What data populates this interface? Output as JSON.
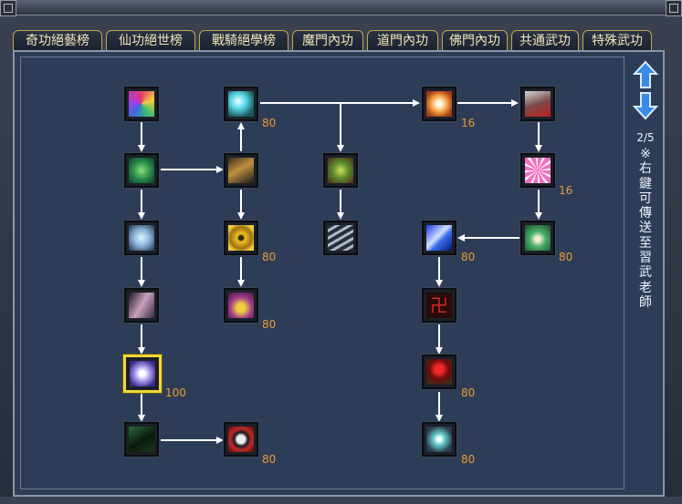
{
  "tabs": [
    {
      "label": "奇功絕藝榜",
      "active": true
    },
    {
      "label": "仙功絕世榜",
      "active": false
    },
    {
      "label": "戰騎絕學榜",
      "active": false
    },
    {
      "label": "魔門內功",
      "active": false
    },
    {
      "label": "道門內功",
      "active": false
    },
    {
      "label": "佛門內功",
      "active": false
    },
    {
      "label": "共通武功",
      "active": false
    },
    {
      "label": "特殊武功",
      "active": false
    }
  ],
  "side": {
    "page_indicator": "2/5",
    "hint": "※右鍵可傳送至習武老師",
    "up_arrow": "arrow-up-icon",
    "down_arrow": "arrow-down-icon"
  },
  "skills": [
    {
      "name": "rainbow-wave",
      "level": "",
      "selected": false
    },
    {
      "name": "ice-shards",
      "level": "80",
      "selected": false
    },
    {
      "name": "glowing-hand",
      "level": "16",
      "selected": false
    },
    {
      "name": "crimson-cloak",
      "level": "",
      "selected": false
    },
    {
      "name": "green-leaf",
      "level": "",
      "selected": false
    },
    {
      "name": "dark-peak",
      "level": "",
      "selected": false
    },
    {
      "name": "green-vortex",
      "level": "",
      "selected": false
    },
    {
      "name": "pink-bloom",
      "level": "16",
      "selected": false
    },
    {
      "name": "frost-burst",
      "level": "",
      "selected": false
    },
    {
      "name": "golden-seal",
      "level": "80",
      "selected": false
    },
    {
      "name": "steel-wings",
      "level": "",
      "selected": false
    },
    {
      "name": "blue-slash",
      "level": "80",
      "selected": false
    },
    {
      "name": "lotus-figure",
      "level": "80",
      "selected": false
    },
    {
      "name": "violet-feather",
      "level": "",
      "selected": false
    },
    {
      "name": "monk-meditation",
      "level": "80",
      "selected": false
    },
    {
      "name": "swastika-seal",
      "level": "",
      "selected": false
    },
    {
      "name": "radiant-star",
      "level": "100",
      "selected": true
    },
    {
      "name": "red-rose",
      "level": "80",
      "selected": false
    },
    {
      "name": "shadow-panther",
      "level": "",
      "selected": false
    },
    {
      "name": "yin-yang",
      "level": "80",
      "selected": false
    },
    {
      "name": "all-seeing-eye",
      "level": "80",
      "selected": false
    }
  ],
  "colors": {
    "panel": "#2e3d57",
    "tab_text": "#f1e7b9",
    "tab_border": "#c4a54a",
    "level_text": "#e89a3a",
    "selected_border": "#f0d83a",
    "connector": "#ffffff",
    "arrow_button": "#3a8ae8"
  }
}
